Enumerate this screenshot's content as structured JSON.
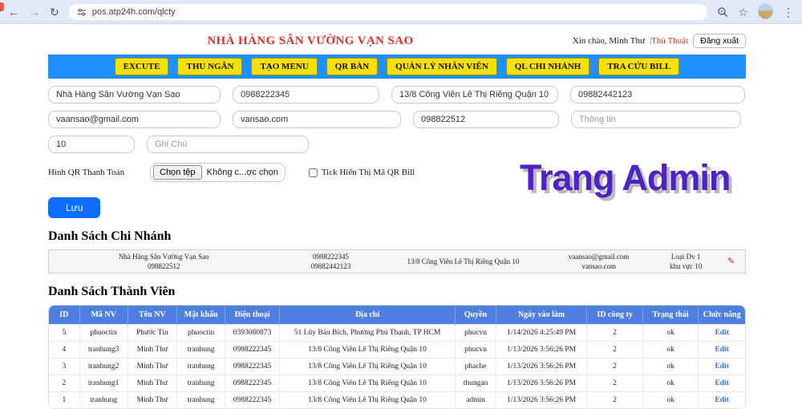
{
  "browser": {
    "url": "pos.atp24h.com/qlcty"
  },
  "header": {
    "title": "NHÀ HÀNG SÂN VƯỜNG VẠN SAO",
    "greeting_prefix": "Xin chào, Minh Thư",
    "greeting_highlight": "|Thủ Thuật",
    "logout_label": "Đăng xuất"
  },
  "nav": {
    "items": [
      "EXCUTE",
      "THU NGÂN",
      "TẠO MENU",
      "QR BÀN",
      "QUẢN LÝ NHÂN VIÊN",
      "QL CHI NHÁNH",
      "TRA CỨU BILL"
    ]
  },
  "form": {
    "name": "Nhà Hàng Sân Vường Vạn Sao",
    "phone": "0988222345",
    "address": "13/8 Công Viên Lê Thị Riêng Quận 10",
    "phone2": "09882442123",
    "email": "vaansao@gmail.com",
    "website": "vansao.com",
    "hotline": "098822512",
    "info_placeholder": "Thông tin",
    "region": "10",
    "note_placeholder": "Ghi Chú",
    "qr_label": "Hình QR Thanh Toán",
    "file_button": "Chọn tệp",
    "file_status": "Không c...ợc chọn",
    "qr_checkbox_label": "Tick Hiển Thị Mã QR Bill",
    "save_label": "Lưu"
  },
  "watermark": "Trang Admin",
  "branches": {
    "heading": "Danh Sách Chi Nhánh",
    "row": {
      "name_line1": "Nhà Hàng Sân Vường Vạn Sao",
      "name_line2": "098822512",
      "phone_line1": "0988222345",
      "phone_line2": "09882442123",
      "address": "13/8 Công Viên Lê Thị Riêng Quận 10",
      "email_line1": "vaansao@gmail.com",
      "email_line2": "vansao.com",
      "meta_line1": "Loại Dv 1",
      "meta_line2": "khu vực 10"
    }
  },
  "members": {
    "heading": "Danh Sách Thành Viên",
    "columns": [
      "ID",
      "Mã NV",
      "Tên NV",
      "Mật khẩu",
      "Điện thoại",
      "Địa chỉ",
      "Quyền",
      "Ngày vào làm",
      "ID công ty",
      "Trạng thái",
      "Chức năng"
    ],
    "edit_label": "Edit",
    "rows": [
      [
        "5",
        "phuoctin",
        "Phước Tín",
        "phuoctin",
        "0393080873",
        "51 Lũy Bán Bích, Phường Phú Thạnh, TP HCM",
        "phucvu",
        "1/14/2026 4:25:49 PM",
        "2",
        "ok"
      ],
      [
        "4",
        "tranhung3",
        "Minh Thư",
        "tranhung",
        "0988222345",
        "13/8 Công Viên Lê Thị Riêng Quận 10",
        "phucvu",
        "1/13/2026 3:56:26 PM",
        "2",
        "ok"
      ],
      [
        "3",
        "tranhung2",
        "Minh Thư",
        "tranhung",
        "0988222345",
        "13/8 Công Viên Lê Thị Riêng Quận 10",
        "phache",
        "1/13/2026 3:56:26 PM",
        "2",
        "ok"
      ],
      [
        "2",
        "tranhung1",
        "Minh Thư",
        "tranhung",
        "0988222345",
        "13/8 Công Viên Lê Thị Riêng Quận 10",
        "thungan",
        "1/13/2026 3:56:26 PM",
        "2",
        "ok"
      ],
      [
        "1",
        "tranhung",
        "Minh Thư",
        "tranhung",
        "0988222345",
        "13/8 Công Viên Lê Thị Riêng Quận 10",
        "admin",
        "1/13/2026 3:56:26 PM",
        "2",
        "ok"
      ]
    ]
  },
  "colors": {
    "nav_blue": "#1e90ff",
    "button_yellow": "#f5e104",
    "title_red": "#e0302a",
    "table_header_blue": "#4e7fe0",
    "save_blue": "#0d6efd",
    "watermark_purple": "#4f22c8"
  }
}
